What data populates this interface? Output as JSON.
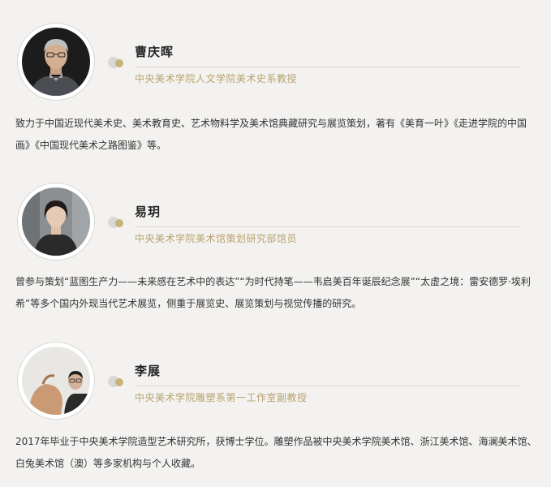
{
  "profiles": [
    {
      "name": "曹庆晖",
      "title": "中央美术学院人文学院美术史系教授",
      "bio": "致力于中国近现代美术史、美术教育史、艺术物料学及美术馆典藏研究与展览策划，著有《美育一叶》《走进学院的中国画》《中国现代美术之路图鉴》等。",
      "photo": "portrait-man-glasses-dark-background"
    },
    {
      "name": "易玥",
      "title": "中央美术学院美术馆策划研究部馆员",
      "bio": "曾参与策划“蓝图生产力——未来感在艺术中的表达”“为时代持笔——韦启美百年诞辰纪念展”“太虚之境：雷安德罗·埃利希”等多个国内外现当代艺术展览，侧重于展览史、展览策划与视觉传播的研究。",
      "photo": "portrait-woman-short-hair"
    },
    {
      "name": "李展",
      "title": "中央美术学院雕塑系第一工作室副教授",
      "bio": "2017年毕业于中央美术学院造型艺术研究所，获博士学位。雕塑作品被中央美术学院美术馆、浙江美术馆、海澜美术馆、白兔美术馆（澳）等多家机构与个人收藏。",
      "photo": "portrait-man-with-apple-sculpture"
    }
  ],
  "colors": {
    "background": "#f3f2f0",
    "accent_gold": "#c7b27a",
    "title_gold": "#b8a36e",
    "dot_grey": "#d9d8d6"
  }
}
